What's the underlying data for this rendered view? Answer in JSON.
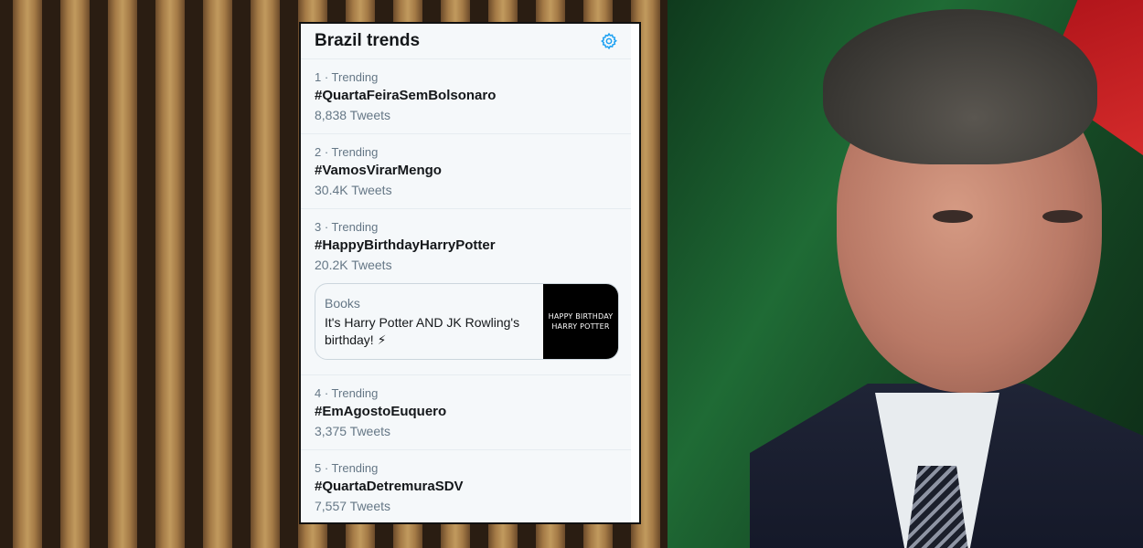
{
  "panel": {
    "title": "Brazil trends",
    "settings_icon": "gear-icon",
    "accent_color": "#1da1f2"
  },
  "trends": [
    {
      "meta": "1 · Trending",
      "tag": "#QuartaFeiraSemBolsonaro",
      "count": "8,838 Tweets"
    },
    {
      "meta": "2 · Trending",
      "tag": "#VamosVirarMengo",
      "count": "30.4K Tweets"
    },
    {
      "meta": "3 · Trending",
      "tag": "#HappyBirthdayHarryPotter",
      "count": "20.2K Tweets",
      "card": {
        "category": "Books",
        "description": "It's Harry Potter AND JK Rowling's birthday! ⚡",
        "image_text_line1": "HAPPY BIRTHDAY",
        "image_text_line2": "HARRY POTTER"
      }
    },
    {
      "meta": "4 · Trending",
      "tag": "#EmAgostoEuquero",
      "count": "3,375 Tweets"
    },
    {
      "meta": "5 · Trending",
      "tag": "#QuartaDetremuraSDV",
      "count": "7,557 Tweets"
    }
  ]
}
